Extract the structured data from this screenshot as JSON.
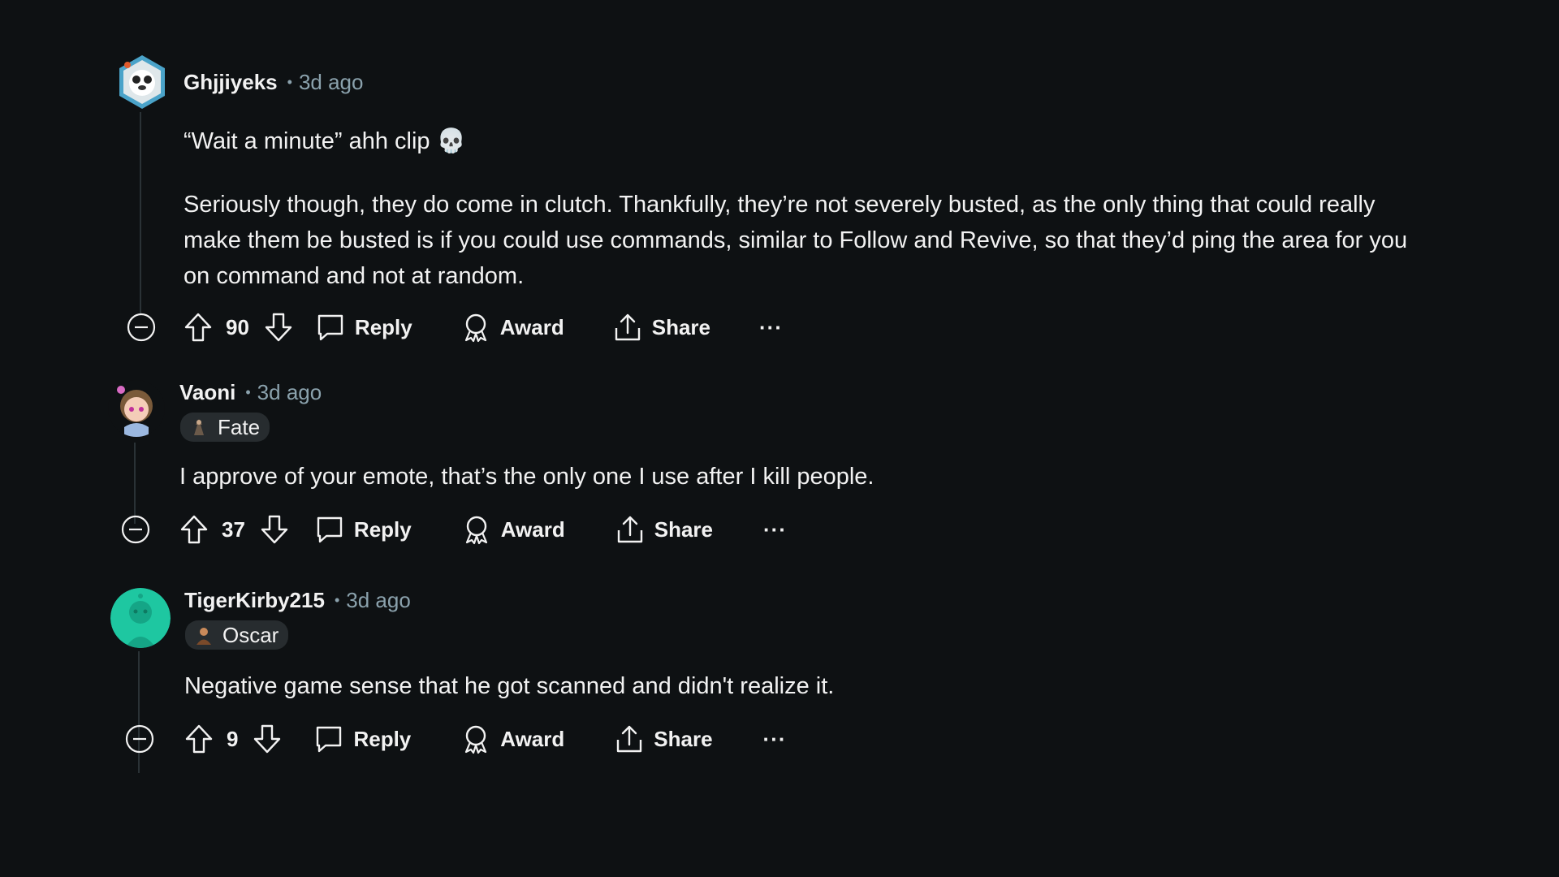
{
  "comments": [
    {
      "username": "Ghjjiyeks",
      "separator": "•",
      "time": "3d ago",
      "flair": null,
      "paragraphs": [
        "“Wait a minute” ahh clip 💀",
        "Seriously though, they do come in clutch. Thankfully, they’re not severely busted, as the only thing that could really make them be busted is if you could use commands, similar to Follow and Revive, so that they’d ping the area for you on command and not at random."
      ],
      "votes": "90",
      "reply_label": "Reply",
      "award_label": "Award",
      "share_label": "Share",
      "more_label": "···"
    },
    {
      "username": "Vaoni",
      "separator": "•",
      "time": "3d ago",
      "flair": "Fate",
      "paragraphs": [
        "I approve of your emote, that’s the only one I use after I kill people."
      ],
      "votes": "37",
      "reply_label": "Reply",
      "award_label": "Award",
      "share_label": "Share",
      "more_label": "···"
    },
    {
      "username": "TigerKirby215",
      "separator": "•",
      "time": "3d ago",
      "flair": "Oscar",
      "paragraphs": [
        "Negative game sense that he got scanned and didn't realize it."
      ],
      "votes": "9",
      "reply_label": "Reply",
      "award_label": "Award",
      "share_label": "Share",
      "more_label": "···"
    }
  ],
  "colors": {
    "background": "#0e1113",
    "text": "#f2f2f2",
    "meta": "#8ba2ad",
    "flair_bg": "#272c2f",
    "thread_line": "#2a3236"
  }
}
